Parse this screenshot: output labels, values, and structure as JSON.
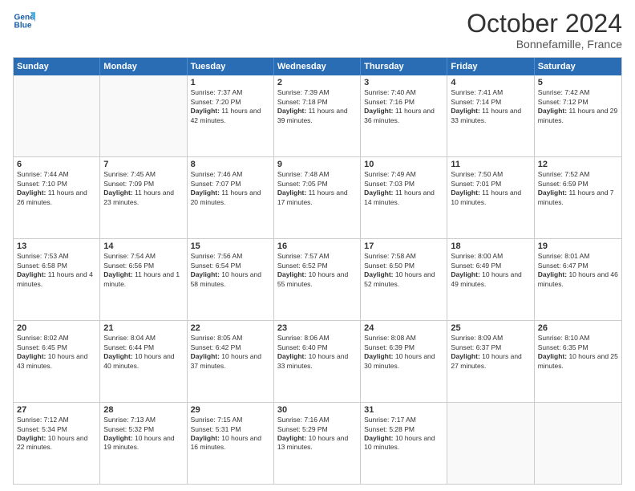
{
  "logo": {
    "line1": "General",
    "line2": "Blue"
  },
  "title": "October 2024",
  "location": "Bonnefamille, France",
  "header": {
    "days": [
      "Sunday",
      "Monday",
      "Tuesday",
      "Wednesday",
      "Thursday",
      "Friday",
      "Saturday"
    ]
  },
  "rows": [
    [
      {
        "day": "",
        "empty": true
      },
      {
        "day": "",
        "empty": true
      },
      {
        "day": "1",
        "sunrise": "Sunrise: 7:37 AM",
        "sunset": "Sunset: 7:20 PM",
        "daylight": "Daylight: 11 hours and 42 minutes."
      },
      {
        "day": "2",
        "sunrise": "Sunrise: 7:39 AM",
        "sunset": "Sunset: 7:18 PM",
        "daylight": "Daylight: 11 hours and 39 minutes."
      },
      {
        "day": "3",
        "sunrise": "Sunrise: 7:40 AM",
        "sunset": "Sunset: 7:16 PM",
        "daylight": "Daylight: 11 hours and 36 minutes."
      },
      {
        "day": "4",
        "sunrise": "Sunrise: 7:41 AM",
        "sunset": "Sunset: 7:14 PM",
        "daylight": "Daylight: 11 hours and 33 minutes."
      },
      {
        "day": "5",
        "sunrise": "Sunrise: 7:42 AM",
        "sunset": "Sunset: 7:12 PM",
        "daylight": "Daylight: 11 hours and 29 minutes."
      }
    ],
    [
      {
        "day": "6",
        "sunrise": "Sunrise: 7:44 AM",
        "sunset": "Sunset: 7:10 PM",
        "daylight": "Daylight: 11 hours and 26 minutes."
      },
      {
        "day": "7",
        "sunrise": "Sunrise: 7:45 AM",
        "sunset": "Sunset: 7:09 PM",
        "daylight": "Daylight: 11 hours and 23 minutes."
      },
      {
        "day": "8",
        "sunrise": "Sunrise: 7:46 AM",
        "sunset": "Sunset: 7:07 PM",
        "daylight": "Daylight: 11 hours and 20 minutes."
      },
      {
        "day": "9",
        "sunrise": "Sunrise: 7:48 AM",
        "sunset": "Sunset: 7:05 PM",
        "daylight": "Daylight: 11 hours and 17 minutes."
      },
      {
        "day": "10",
        "sunrise": "Sunrise: 7:49 AM",
        "sunset": "Sunset: 7:03 PM",
        "daylight": "Daylight: 11 hours and 14 minutes."
      },
      {
        "day": "11",
        "sunrise": "Sunrise: 7:50 AM",
        "sunset": "Sunset: 7:01 PM",
        "daylight": "Daylight: 11 hours and 10 minutes."
      },
      {
        "day": "12",
        "sunrise": "Sunrise: 7:52 AM",
        "sunset": "Sunset: 6:59 PM",
        "daylight": "Daylight: 11 hours and 7 minutes."
      }
    ],
    [
      {
        "day": "13",
        "sunrise": "Sunrise: 7:53 AM",
        "sunset": "Sunset: 6:58 PM",
        "daylight": "Daylight: 11 hours and 4 minutes."
      },
      {
        "day": "14",
        "sunrise": "Sunrise: 7:54 AM",
        "sunset": "Sunset: 6:56 PM",
        "daylight": "Daylight: 11 hours and 1 minute."
      },
      {
        "day": "15",
        "sunrise": "Sunrise: 7:56 AM",
        "sunset": "Sunset: 6:54 PM",
        "daylight": "Daylight: 10 hours and 58 minutes."
      },
      {
        "day": "16",
        "sunrise": "Sunrise: 7:57 AM",
        "sunset": "Sunset: 6:52 PM",
        "daylight": "Daylight: 10 hours and 55 minutes."
      },
      {
        "day": "17",
        "sunrise": "Sunrise: 7:58 AM",
        "sunset": "Sunset: 6:50 PM",
        "daylight": "Daylight: 10 hours and 52 minutes."
      },
      {
        "day": "18",
        "sunrise": "Sunrise: 8:00 AM",
        "sunset": "Sunset: 6:49 PM",
        "daylight": "Daylight: 10 hours and 49 minutes."
      },
      {
        "day": "19",
        "sunrise": "Sunrise: 8:01 AM",
        "sunset": "Sunset: 6:47 PM",
        "daylight": "Daylight: 10 hours and 46 minutes."
      }
    ],
    [
      {
        "day": "20",
        "sunrise": "Sunrise: 8:02 AM",
        "sunset": "Sunset: 6:45 PM",
        "daylight": "Daylight: 10 hours and 43 minutes."
      },
      {
        "day": "21",
        "sunrise": "Sunrise: 8:04 AM",
        "sunset": "Sunset: 6:44 PM",
        "daylight": "Daylight: 10 hours and 40 minutes."
      },
      {
        "day": "22",
        "sunrise": "Sunrise: 8:05 AM",
        "sunset": "Sunset: 6:42 PM",
        "daylight": "Daylight: 10 hours and 37 minutes."
      },
      {
        "day": "23",
        "sunrise": "Sunrise: 8:06 AM",
        "sunset": "Sunset: 6:40 PM",
        "daylight": "Daylight: 10 hours and 33 minutes."
      },
      {
        "day": "24",
        "sunrise": "Sunrise: 8:08 AM",
        "sunset": "Sunset: 6:39 PM",
        "daylight": "Daylight: 10 hours and 30 minutes."
      },
      {
        "day": "25",
        "sunrise": "Sunrise: 8:09 AM",
        "sunset": "Sunset: 6:37 PM",
        "daylight": "Daylight: 10 hours and 27 minutes."
      },
      {
        "day": "26",
        "sunrise": "Sunrise: 8:10 AM",
        "sunset": "Sunset: 6:35 PM",
        "daylight": "Daylight: 10 hours and 25 minutes."
      }
    ],
    [
      {
        "day": "27",
        "sunrise": "Sunrise: 7:12 AM",
        "sunset": "Sunset: 5:34 PM",
        "daylight": "Daylight: 10 hours and 22 minutes."
      },
      {
        "day": "28",
        "sunrise": "Sunrise: 7:13 AM",
        "sunset": "Sunset: 5:32 PM",
        "daylight": "Daylight: 10 hours and 19 minutes."
      },
      {
        "day": "29",
        "sunrise": "Sunrise: 7:15 AM",
        "sunset": "Sunset: 5:31 PM",
        "daylight": "Daylight: 10 hours and 16 minutes."
      },
      {
        "day": "30",
        "sunrise": "Sunrise: 7:16 AM",
        "sunset": "Sunset: 5:29 PM",
        "daylight": "Daylight: 10 hours and 13 minutes."
      },
      {
        "day": "31",
        "sunrise": "Sunrise: 7:17 AM",
        "sunset": "Sunset: 5:28 PM",
        "daylight": "Daylight: 10 hours and 10 minutes."
      },
      {
        "day": "",
        "empty": true
      },
      {
        "day": "",
        "empty": true
      }
    ]
  ]
}
